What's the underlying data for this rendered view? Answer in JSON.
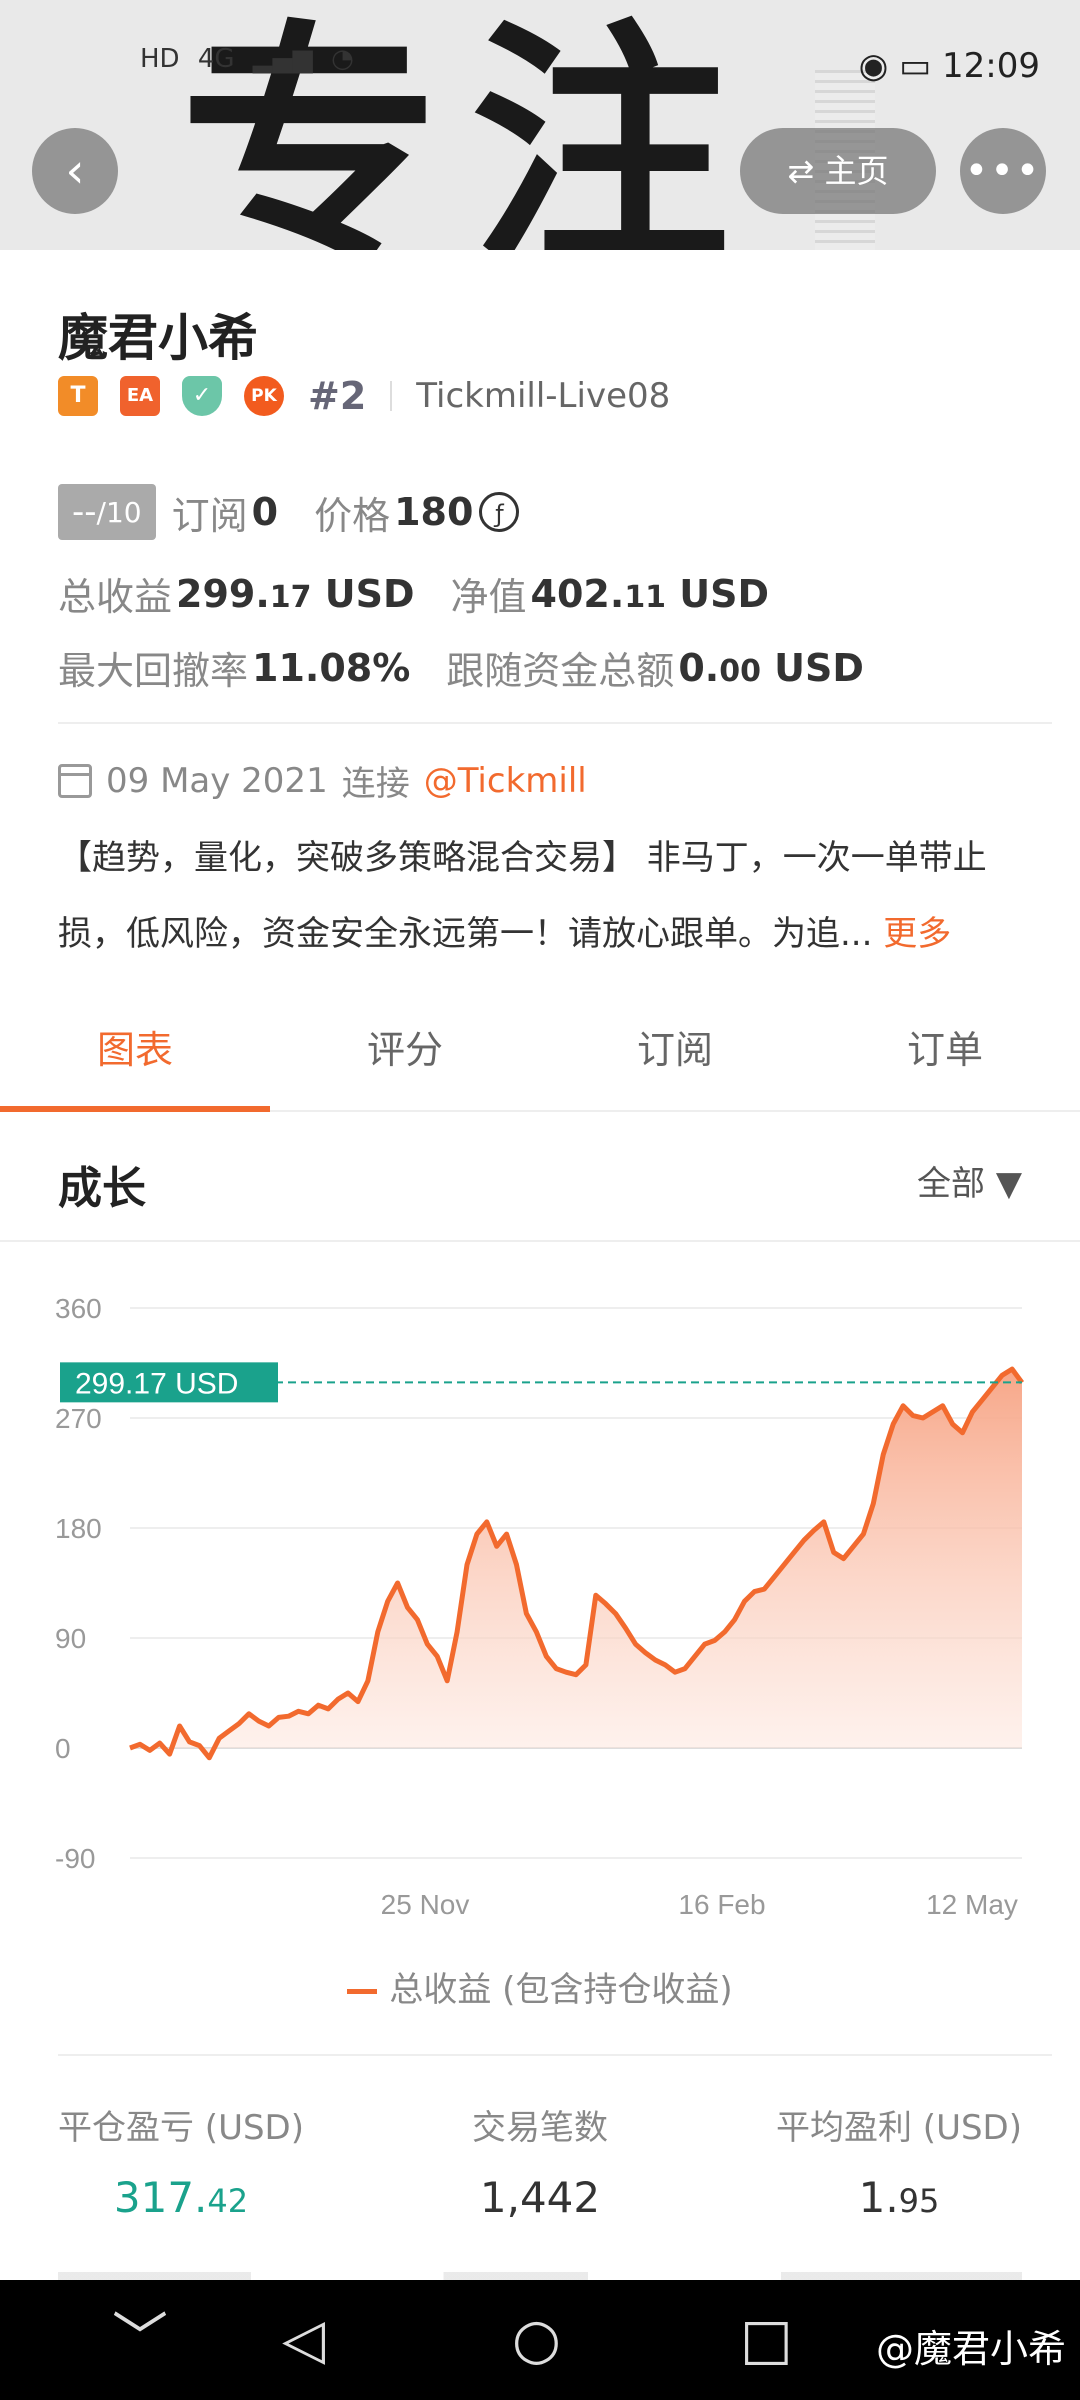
{
  "status_bar": {
    "hd": "HD",
    "network": "4G",
    "time": "12:09"
  },
  "top_nav": {
    "home_label": "⇄ 主页",
    "back_glyph": "‹",
    "more_glyph": "•••"
  },
  "profile": {
    "name": "魔君小希",
    "badges": [
      "T",
      "EA",
      "✓",
      "PK"
    ],
    "rank": "#2",
    "account": "Tickmill-Live08"
  },
  "metrics": {
    "score": "--",
    "score_of": "/10",
    "subscribe_label": "订阅",
    "subscribe_value": "0",
    "price_label": "价格",
    "price_value": "180",
    "price_currency_glyph": "ƒ",
    "total_profit_label": "总收益",
    "total_profit_int": "299.",
    "total_profit_dec": "17",
    "total_profit_unit": " USD",
    "equity_label": "净值",
    "equity_int": "402.",
    "equity_dec": "11",
    "equity_unit": " USD",
    "max_drawdown_label": "最大回撤率",
    "max_drawdown_value": "11.08%",
    "follow_funds_label": "跟随资金总额",
    "follow_funds_int": "0.",
    "follow_funds_dec": "00",
    "follow_funds_unit": " USD"
  },
  "connection": {
    "date": "09 May 2021",
    "connect_label": "连接",
    "broker": "@Tickmill"
  },
  "description": {
    "text": "【趋势，量化，突破多策略混合交易】 非马丁，一次一单带止损，低风险，资金安全永远第一！请放心跟单。为追...",
    "more_label": "更多"
  },
  "tabs": [
    "图表",
    "评分",
    "订阅",
    "订单"
  ],
  "section": {
    "title": "成长",
    "filter": "全部 ▼"
  },
  "chart_data": {
    "type": "area",
    "ylim": [
      -90,
      360
    ],
    "yticks": [
      "360",
      "270",
      "180",
      "90",
      "0",
      "-90"
    ],
    "xticks": [
      "25 Nov",
      "16 Feb",
      "12 May"
    ],
    "current_label": "299.17 USD",
    "current_value": 299.17,
    "legend": "总收益 (包含持仓收益)",
    "colors": {
      "line": "#f26a2e",
      "ref": "#1aa28c"
    },
    "series": [
      {
        "name": "总收益 (包含持仓收益)",
        "values": [
          0,
          3,
          -2,
          4,
          -5,
          18,
          5,
          2,
          -8,
          8,
          14,
          20,
          28,
          22,
          18,
          25,
          26,
          30,
          28,
          35,
          32,
          40,
          45,
          38,
          55,
          95,
          120,
          135,
          115,
          105,
          85,
          75,
          55,
          95,
          150,
          175,
          185,
          165,
          175,
          150,
          110,
          95,
          75,
          65,
          62,
          60,
          68,
          125,
          118,
          110,
          98,
          85,
          78,
          72,
          68,
          62,
          65,
          75,
          85,
          88,
          95,
          105,
          120,
          128,
          130,
          140,
          150,
          160,
          170,
          178,
          185,
          160,
          155,
          165,
          175,
          200,
          240,
          265,
          280,
          272,
          270,
          275,
          280,
          265,
          258,
          275,
          285,
          295,
          305,
          310,
          299
        ]
      }
    ]
  },
  "stats": [
    {
      "label": "平仓盈亏 (USD)",
      "int": "317.",
      "dec": "42"
    },
    {
      "label": "交易笔数",
      "int": "1,442",
      "dec": ""
    },
    {
      "label": "平均盈利 (USD)",
      "int": "1.",
      "dec": "95"
    }
  ],
  "nav_bar": {
    "back": "◁",
    "home": "○",
    "recent": "□",
    "down": "﹀",
    "watermark": "@魔君小希"
  }
}
